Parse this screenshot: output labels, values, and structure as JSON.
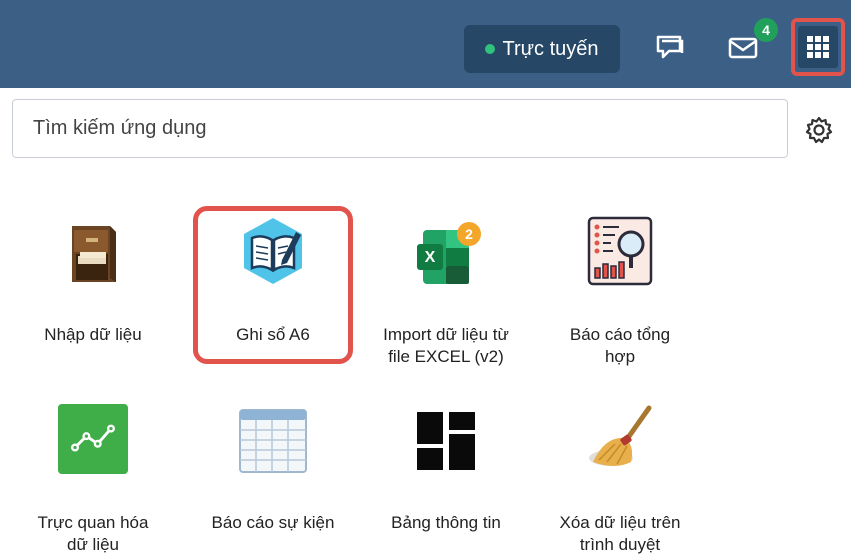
{
  "header": {
    "status_label": "Trực tuyến",
    "status_color": "#2ec27e",
    "chat_icon": "chat-icon",
    "mail_icon": "mail-icon",
    "mail_badge": "4",
    "apps_icon": "apps-grid-icon",
    "highlight_color": "#e2544b"
  },
  "search": {
    "placeholder": "Tìm kiếm ứng dụng",
    "settings_icon": "gear-icon"
  },
  "apps": [
    {
      "label": "Nhập dữ liệu",
      "icon": "cabinet-icon"
    },
    {
      "label": "Ghi sổ A6",
      "icon": "notebook-icon"
    },
    {
      "label": "Import dữ liệu từ\nfile EXCEL (v2)",
      "icon": "excel-icon",
      "badge": "2"
    },
    {
      "label": "Báo cáo tổng\nhợp",
      "icon": "report-icon"
    },
    {
      "label": "Trực quan hóa\ndữ liệu",
      "icon": "line-chart-icon"
    },
    {
      "label": "Báo cáo sự kiện",
      "icon": "table-icon"
    },
    {
      "label": "Bảng thông tin",
      "icon": "dashboard-icon"
    },
    {
      "label": "Xóa dữ liệu trên\ntrình duyệt",
      "icon": "broom-icon"
    }
  ]
}
